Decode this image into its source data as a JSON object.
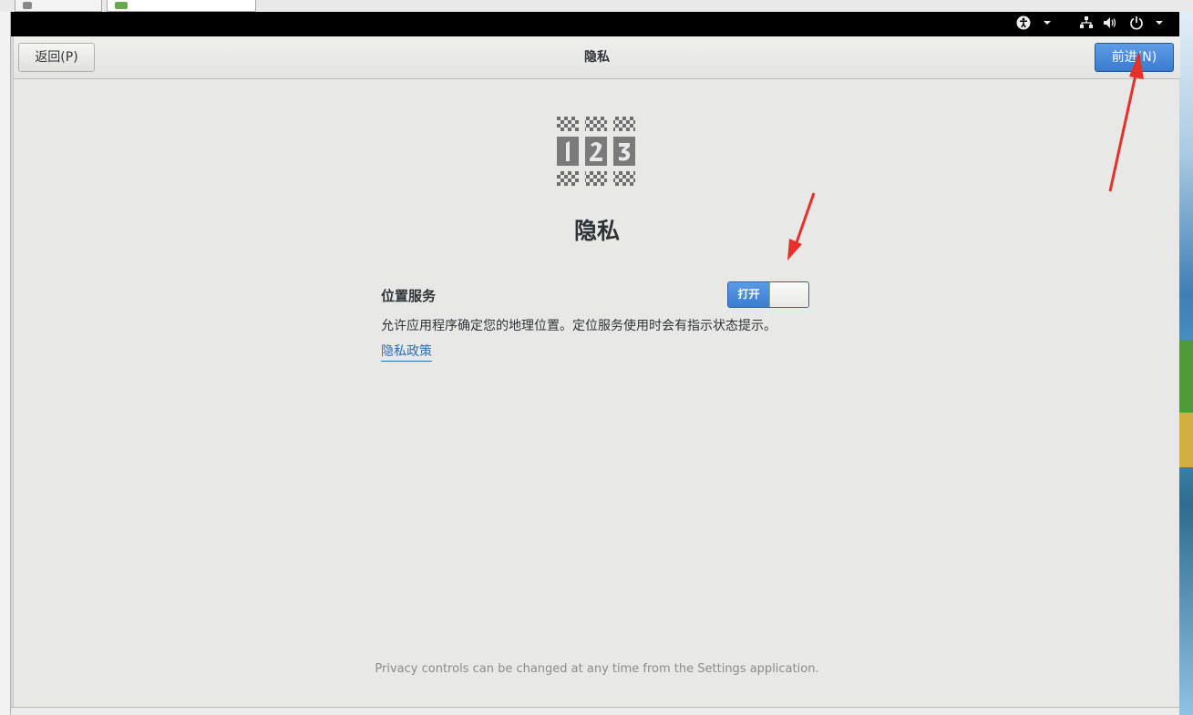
{
  "header": {
    "back_label": "返回(P)",
    "title": "隐私",
    "next_label": "前进(N)"
  },
  "page": {
    "heading": "隐私"
  },
  "location": {
    "label": "位置服务",
    "toggle_state_label": "打开",
    "description": "允许应用程序确定您的地理位置。定位服务使用时会有指示状态提示。"
  },
  "policy_link": "隐私政策",
  "footer": "Privacy controls can be changed at any time from the Settings application.",
  "topbar_icons": [
    "accessibility-icon",
    "network-icon",
    "volume-icon",
    "power-icon"
  ],
  "colors": {
    "accent": "#3a7bd0",
    "annotation": "#e8302a",
    "window_bg": "#e8e8e7"
  }
}
